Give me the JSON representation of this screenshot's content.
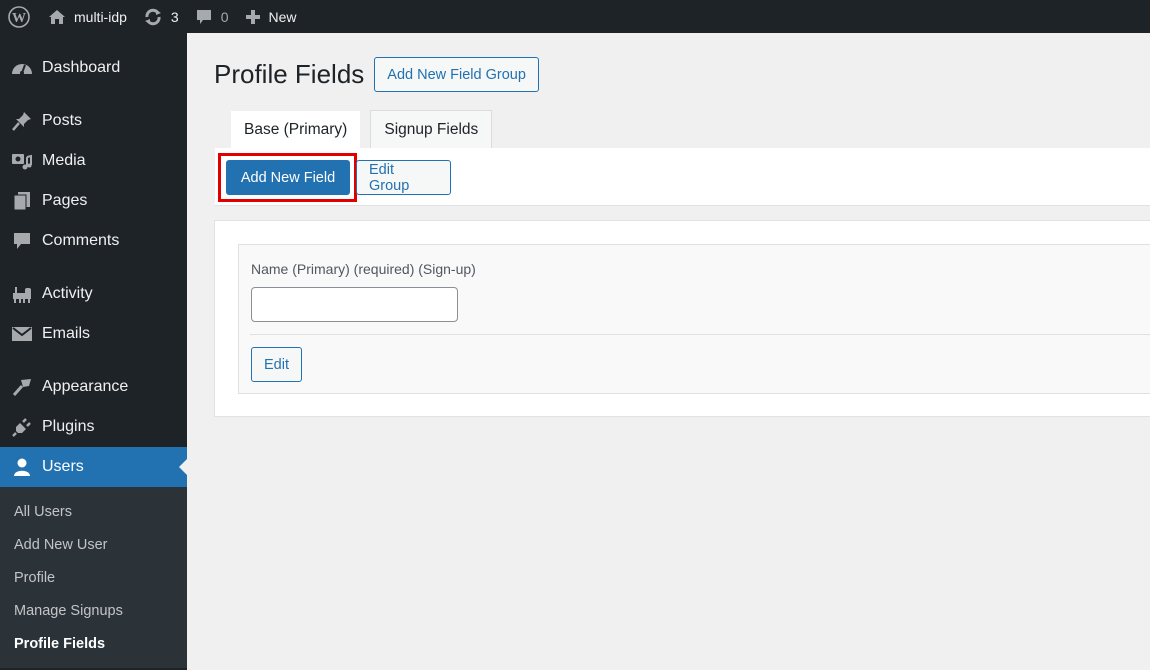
{
  "adminbar": {
    "site_name": "multi-idp",
    "updates_count": "3",
    "comments_count": "0",
    "new_label": "New"
  },
  "sidebar": {
    "items": [
      {
        "label": "Dashboard",
        "icon": "dashboard-icon"
      },
      {
        "label": "Posts",
        "icon": "pin-icon"
      },
      {
        "label": "Media",
        "icon": "media-icon"
      },
      {
        "label": "Pages",
        "icon": "pages-icon"
      },
      {
        "label": "Comments",
        "icon": "comment-icon"
      },
      {
        "label": "Activity",
        "icon": "activity-icon"
      },
      {
        "label": "Emails",
        "icon": "email-icon"
      },
      {
        "label": "Appearance",
        "icon": "brush-icon"
      },
      {
        "label": "Plugins",
        "icon": "plugin-icon"
      },
      {
        "label": "Users",
        "icon": "user-icon",
        "active": true
      }
    ],
    "submenu": [
      {
        "label": "All Users"
      },
      {
        "label": "Add New User"
      },
      {
        "label": "Profile"
      },
      {
        "label": "Manage Signups"
      },
      {
        "label": "Profile Fields",
        "current": true
      }
    ]
  },
  "main": {
    "title": "Profile Fields",
    "add_group_label": "Add New Field Group",
    "tabs": [
      {
        "label": "Base (Primary)",
        "active": true
      },
      {
        "label": "Signup Fields"
      }
    ],
    "add_field_label": "Add New Field",
    "edit_group_label": "Edit Group",
    "field": {
      "label": "Name (Primary) (required) (Sign-up)",
      "value": "",
      "edit_label": "Edit"
    }
  },
  "colors": {
    "accent": "#2271b1",
    "sidebar_bg": "#1d2327",
    "highlight": "#e00000"
  }
}
